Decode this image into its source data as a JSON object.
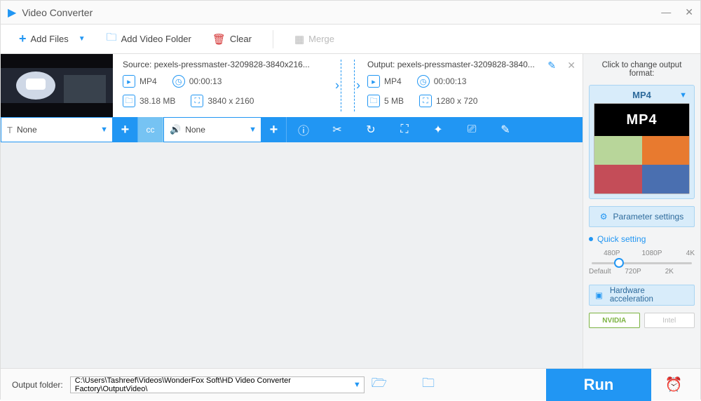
{
  "title": "Video Converter",
  "toolbar": {
    "add_files": "Add Files",
    "add_folder": "Add Video Folder",
    "clear": "Clear",
    "merge": "Merge"
  },
  "file": {
    "source_label": "Source: pexels-pressmaster-3209828-3840x216...",
    "output_label": "Output: pexels-pressmaster-3209828-3840...",
    "src_format": "MP4",
    "src_duration": "00:00:13",
    "src_size": "38.18 MB",
    "src_dims": "3840 x 2160",
    "out_format": "MP4",
    "out_duration": "00:00:13",
    "out_size": "5 MB",
    "out_dims": "1280 x 720"
  },
  "action": {
    "subtitle": "None",
    "audio": "None"
  },
  "right": {
    "hint": "Click to change output format:",
    "format": "MP4",
    "param_settings": "Parameter settings",
    "quick_setting": "Quick setting",
    "ticks_top": [
      "480P",
      "1080P",
      "4K"
    ],
    "ticks_bot": [
      "Default",
      "720P",
      "2K"
    ],
    "hw": "Hardware acceleration",
    "gpu_nv": "NVIDIA",
    "gpu_it": "Intel"
  },
  "bottom": {
    "label": "Output folder:",
    "path": "C:\\Users\\Tashreef\\Videos\\WonderFox Soft\\HD Video Converter Factory\\OutputVideo\\",
    "run": "Run"
  }
}
